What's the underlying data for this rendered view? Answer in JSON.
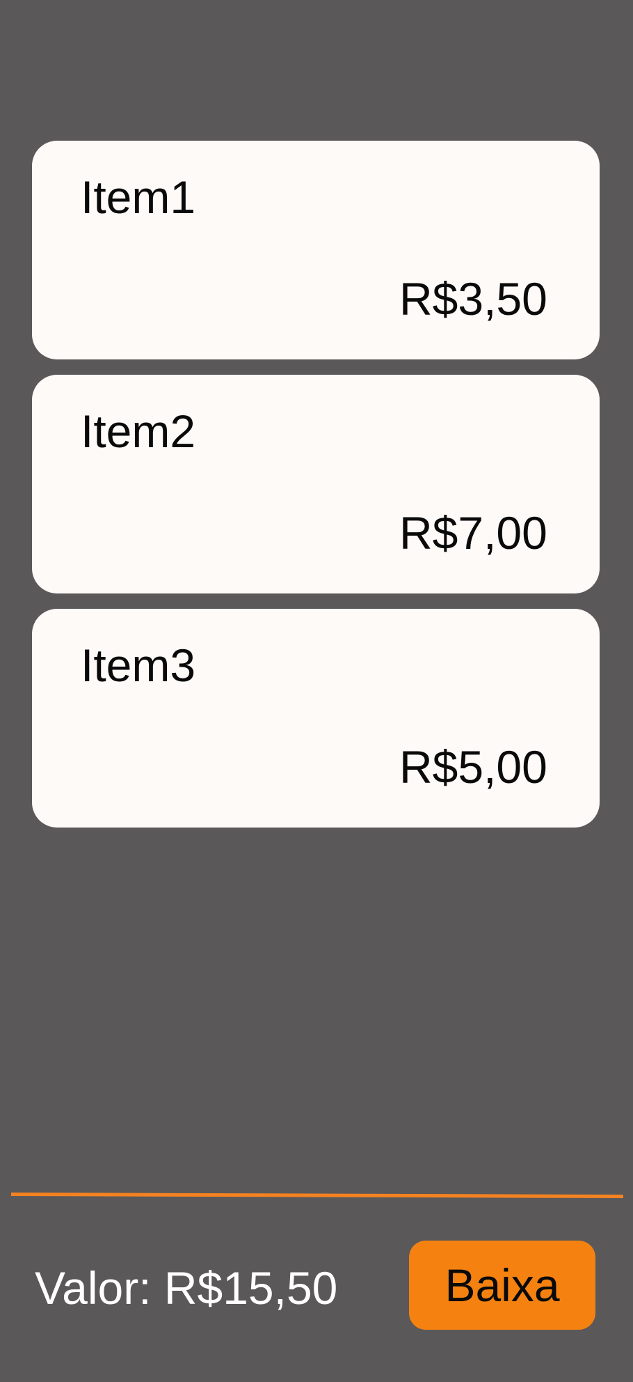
{
  "items": [
    {
      "name": "Item1",
      "price": "R$3,50"
    },
    {
      "name": "Item2",
      "price": "R$7,00"
    },
    {
      "name": "Item3",
      "price": "R$5,00"
    }
  ],
  "footer": {
    "total_text": "Valor: R$15,50",
    "button_label": "Baixa"
  },
  "colors": {
    "background": "#5a5859",
    "card": "#fdfaf8",
    "accent": "#f58210",
    "divider": "#f58220"
  }
}
